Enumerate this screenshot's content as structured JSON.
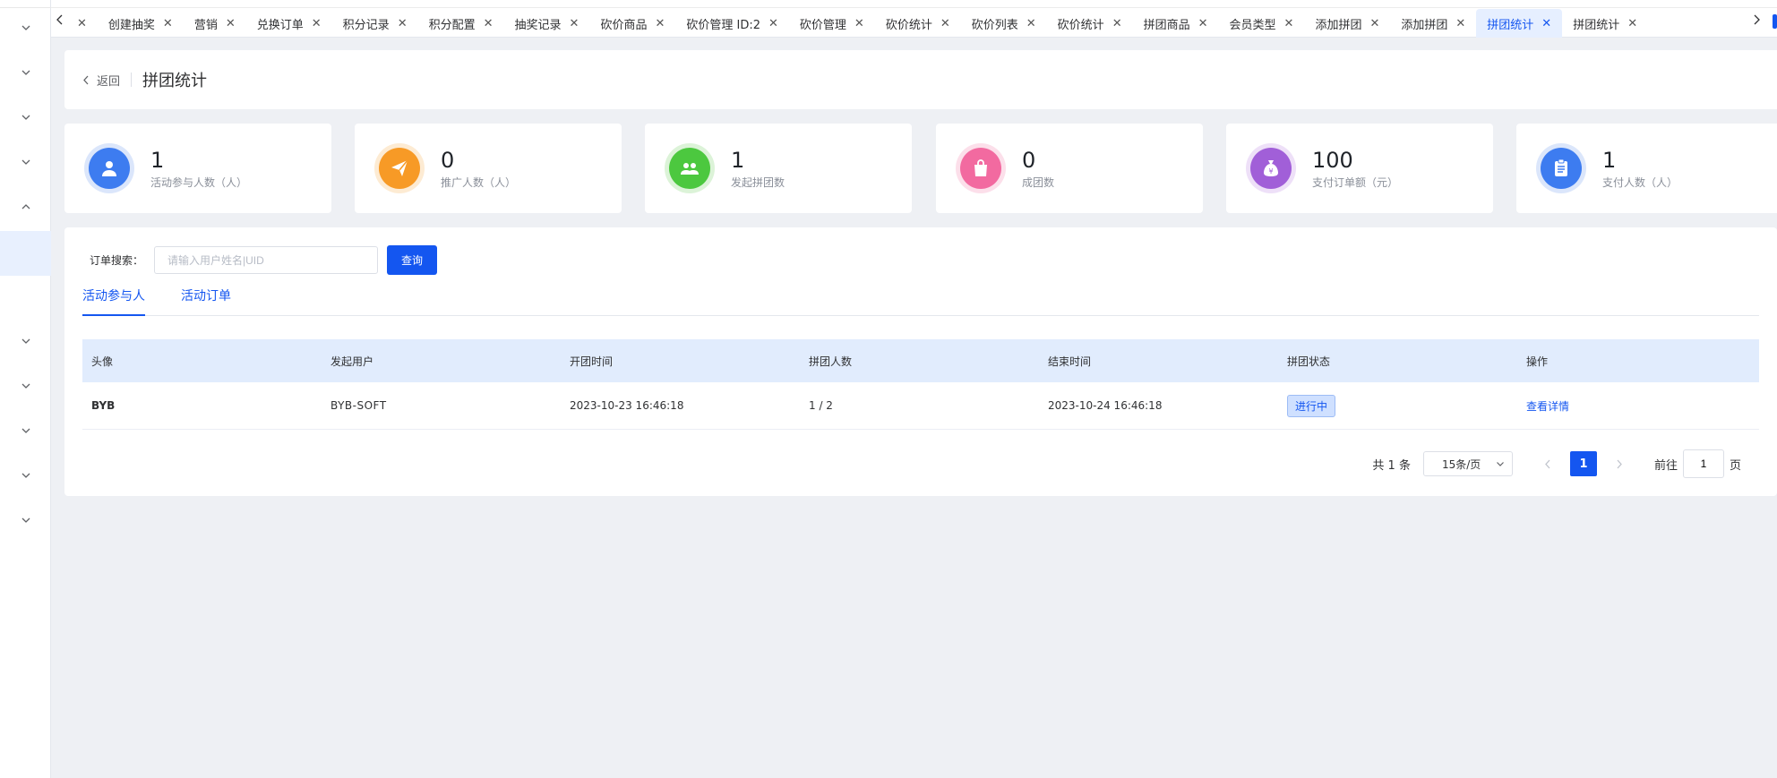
{
  "tabs": [
    {
      "label": "",
      "active": false
    },
    {
      "label": "创建抽奖",
      "active": false
    },
    {
      "label": "营销",
      "active": false
    },
    {
      "label": "兑换订单",
      "active": false
    },
    {
      "label": "积分记录",
      "active": false
    },
    {
      "label": "积分配置",
      "active": false
    },
    {
      "label": "抽奖记录",
      "active": false
    },
    {
      "label": "砍价商品",
      "active": false
    },
    {
      "label": "砍价管理 ID:2",
      "active": false
    },
    {
      "label": "砍价管理",
      "active": false
    },
    {
      "label": "砍价统计",
      "active": false
    },
    {
      "label": "砍价列表",
      "active": false
    },
    {
      "label": "砍价统计",
      "active": false
    },
    {
      "label": "拼团商品",
      "active": false
    },
    {
      "label": "会员类型",
      "active": false
    },
    {
      "label": "添加拼团",
      "active": false
    },
    {
      "label": "添加拼团",
      "active": false
    },
    {
      "label": "拼团统计",
      "active": true
    },
    {
      "label": "拼团统计",
      "active": false
    }
  ],
  "header": {
    "back_label": "返回",
    "title": "拼团统计"
  },
  "stats": [
    {
      "value": "1",
      "label": "活动参与人数（人）",
      "icon": "user-icon",
      "color": "#3d7cf0",
      "ring": "#dbe6fb"
    },
    {
      "value": "0",
      "label": "推广人数（人）",
      "icon": "paper-plane-icon",
      "color": "#f79a26",
      "ring": "#fdebd3"
    },
    {
      "value": "1",
      "label": "发起拼团数",
      "icon": "group-icon",
      "color": "#4cc83f",
      "ring": "#dcf3d8"
    },
    {
      "value": "0",
      "label": "成团数",
      "icon": "shopping-bag-icon",
      "color": "#f26aa0",
      "ring": "#fcdfea"
    },
    {
      "value": "100",
      "label": "支付订单额（元）",
      "icon": "money-bag-icon",
      "color": "#a15fd8",
      "ring": "#eee0f8"
    },
    {
      "value": "1",
      "label": "支付人数（人）",
      "icon": "clipboard-icon",
      "color": "#3d7cf0",
      "ring": "#dbe6fb"
    }
  ],
  "search": {
    "label": "订单搜索：",
    "placeholder": "请输入用户姓名|UID",
    "button": "查询"
  },
  "content_tabs": [
    {
      "label": "活动参与人",
      "active": true
    },
    {
      "label": "活动订单",
      "active": false
    }
  ],
  "table": {
    "headers": [
      "头像",
      "发起用户",
      "开团时间",
      "拼团人数",
      "结束时间",
      "拼团状态",
      "操作"
    ],
    "rows": [
      {
        "avatar": "BYB",
        "user": "BYB-SOFT",
        "start": "2023-10-23 16:46:18",
        "count": "1 / 2",
        "end": "2023-10-24 16:46:18",
        "status": "进行中",
        "action": "查看详情"
      }
    ]
  },
  "pagination": {
    "total": "共 1 条",
    "page_size": "15条/页",
    "current": "1",
    "goto_label": "前往",
    "goto_value": "1",
    "page_suffix": "页"
  }
}
